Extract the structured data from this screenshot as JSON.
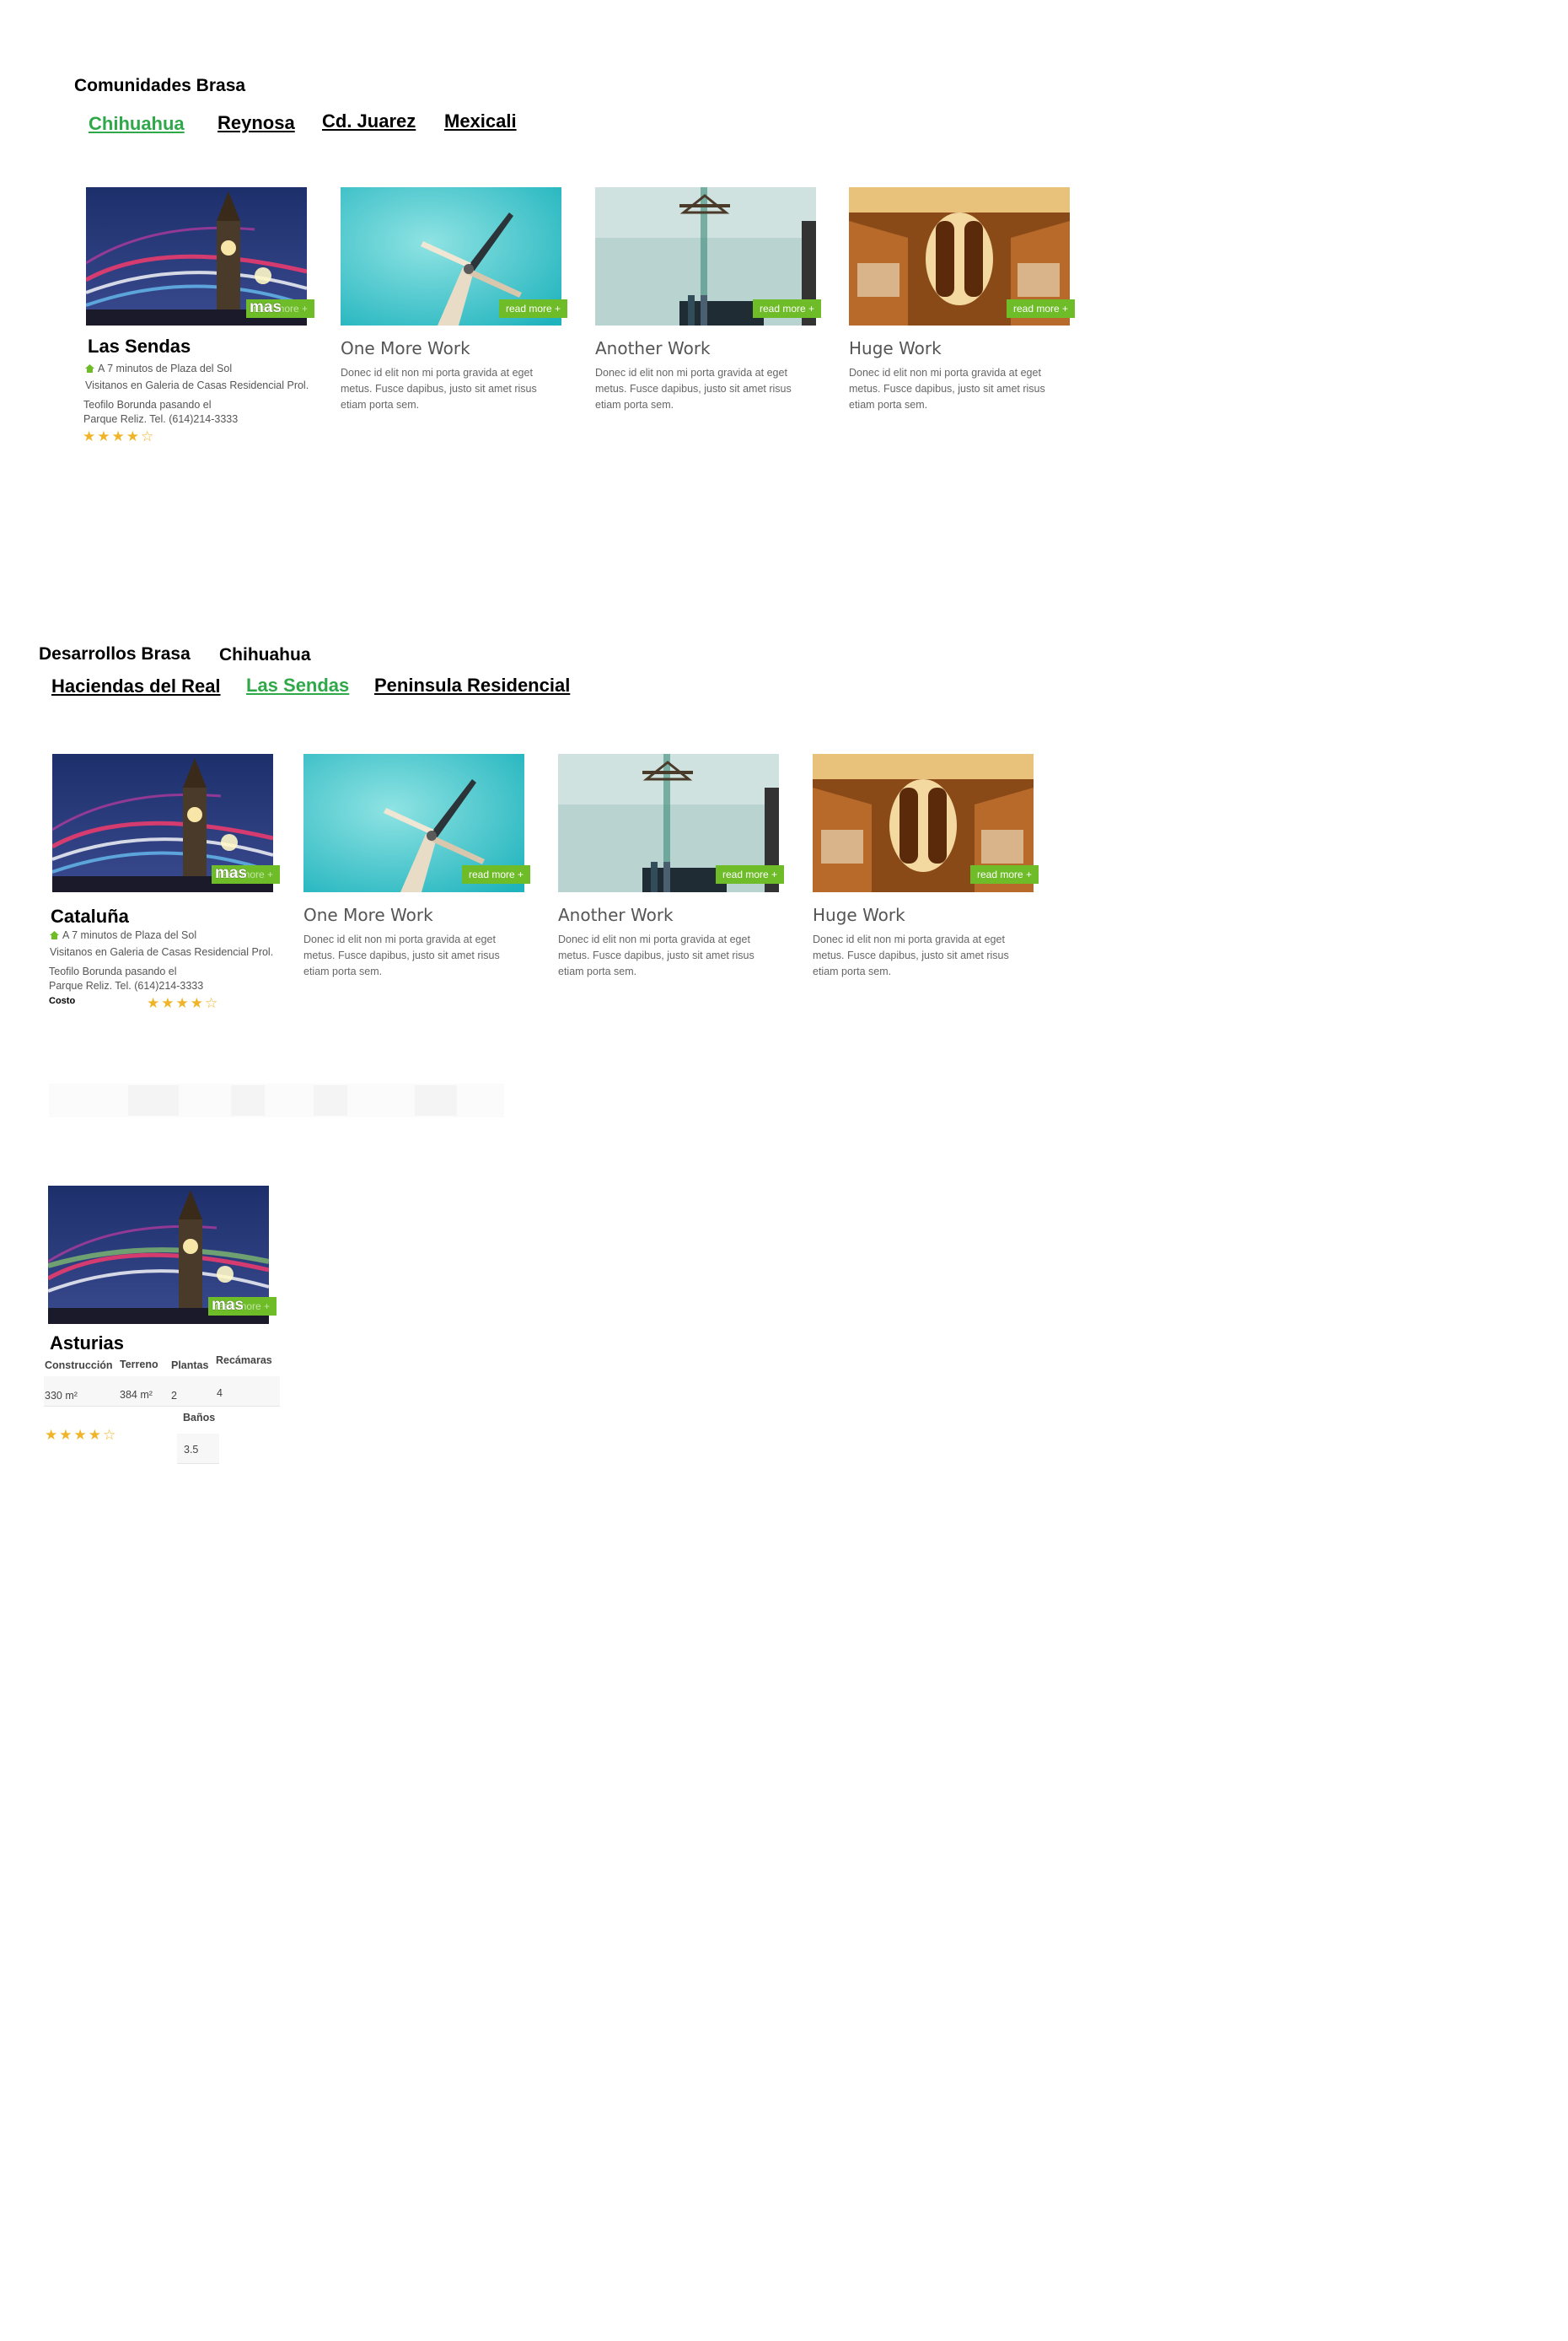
{
  "section1": {
    "title": "Comunidades Brasa",
    "filters": [
      "Chihuahua",
      "Reynosa",
      "Cd. Juarez",
      "Mexicali"
    ],
    "featured": {
      "title": "Las Sendas",
      "badge_overlay": "mas",
      "badge_under": "read more +",
      "location": "A 7 minutos de Plaza del Sol",
      "line2": "Visitanos en Galeria de Casas Residencial Prol.",
      "line3": "Teofilo Borunda pasando el",
      "line4": "Parque Reliz. Tel. (614)214-3333",
      "stars": "★★★★☆"
    },
    "cards": [
      {
        "title": "One More Work",
        "desc": "Donec id elit non mi porta gravida at eget metus. Fusce dapibus, justo sit amet risus etiam porta sem.",
        "badge": "read more +"
      },
      {
        "title": "Another Work",
        "desc": "Donec id elit non mi porta gravida at eget metus. Fusce dapibus, justo sit amet risus etiam porta sem.",
        "badge": "read more +"
      },
      {
        "title": "Huge Work",
        "desc": "Donec id elit non mi porta gravida at eget metus. Fusce dapibus, justo sit amet risus etiam porta sem.",
        "badge": "read more +"
      }
    ]
  },
  "section2": {
    "title": "Desarrollos Brasa",
    "subtitle": "Chihuahua",
    "filters": [
      "Haciendas del Real",
      "Las Sendas",
      "Peninsula Residencial"
    ],
    "featured": {
      "title": "Cataluña",
      "badge_overlay": "mas",
      "badge_under": "read more +",
      "location": "A 7 minutos de Plaza del Sol",
      "line2": "Visitanos en Galeria de Casas Residencial Prol.",
      "line3": "Teofilo Borunda pasando el",
      "line4": "Parque Reliz. Tel. (614)214-3333",
      "costo_label": "Costo",
      "stars": "★★★★☆"
    },
    "cards": [
      {
        "title": "One More Work",
        "desc": "Donec id elit non mi porta gravida at eget metus. Fusce dapibus, justo sit amet risus etiam porta sem.",
        "badge": "read more +"
      },
      {
        "title": "Another Work",
        "desc": "Donec id elit non mi porta gravida at eget metus. Fusce dapibus, justo sit amet risus etiam porta sem.",
        "badge": "read more +"
      },
      {
        "title": "Huge Work",
        "desc": "Donec id elit non mi porta gravida at eget metus. Fusce dapibus, justo sit amet risus etiam porta sem.",
        "badge": "read more +"
      }
    ]
  },
  "section3": {
    "featured": {
      "title": "Asturias",
      "badge_overlay": "mas",
      "badge_under": "read more +",
      "specs_headers": [
        "Construcción",
        "Terreno",
        "Plantas",
        "Recámaras",
        "Baños"
      ],
      "specs_values": [
        "330 m²",
        "384 m²",
        "2",
        "4",
        "3.5"
      ],
      "stars": "★★★★☆"
    }
  },
  "colors": {
    "accent_green": "#6ebc27",
    "active_filter": "#2fa84a",
    "star": "#f0b429"
  }
}
